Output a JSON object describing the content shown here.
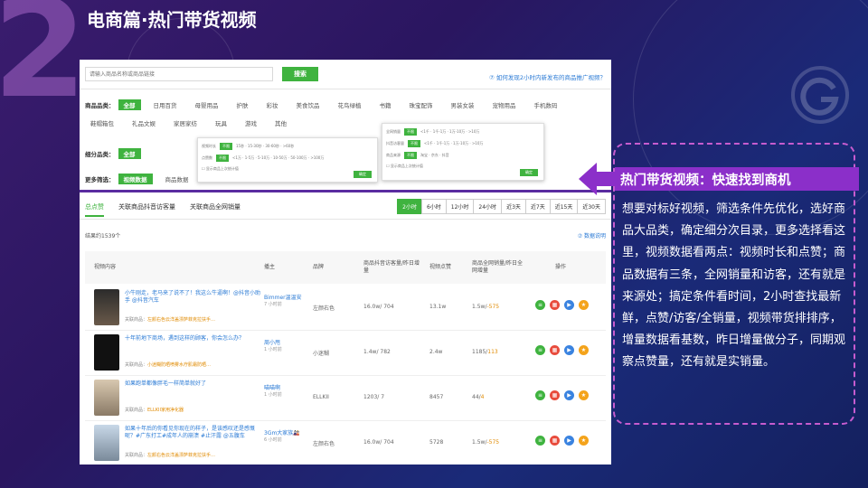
{
  "slide": {
    "number": "2",
    "title": "电商篇·热门带货视频"
  },
  "search": {
    "placeholder": "请输入商品名称或商品链接",
    "button_label": "搜索",
    "help_link": "⑦ 如何发现2小时内新发布的商品推广视频？"
  },
  "filters": {
    "category_label": "商品品类：",
    "categories": [
      "全部",
      "日用百货",
      "母婴用品",
      "护肤",
      "彩妆",
      "美食饮品",
      "花鸟绿植",
      "书籍",
      "珠宝配饰",
      "男装女装",
      "宠物用品",
      "手机数码",
      "鞋帽箱包",
      "礼品文娱",
      "家居家纺",
      "玩具",
      "游戏",
      "其他"
    ],
    "subcategory_label": "细分品类：",
    "subcategory_selected": "全部",
    "more_label": "更多筛选：",
    "more_options": [
      "视频数据",
      "商品数据"
    ]
  },
  "tabs": {
    "items": [
      "总点赞",
      "关联商品抖音访客量",
      "关联商品全网销量"
    ],
    "active_index": 0
  },
  "time_filters": {
    "items": [
      "2小时",
      "6小时",
      "12小时",
      "24小时",
      "近3天",
      "近7天",
      "近15天",
      "近30天"
    ],
    "active_index": 0
  },
  "results": {
    "count_text": "结果约1539个",
    "data_explain": "⑦ 数据说明"
  },
  "table": {
    "headers": [
      "视频内容",
      "播主",
      "品牌",
      "商品抖音访客量/昨日增量",
      "视频点赞",
      "商品全网销量/昨日全网增量",
      "操作"
    ],
    "rows": [
      {
        "title": "小牛刚走，老马来了说不了！我这么牛逼啊！@抖音小助手 @抖音汽车",
        "related_label": "关联商品：",
        "related": "左颜右色云洋盖漂萨菲克拉扶手…",
        "author": "Bimmer温温安",
        "ago": "7 小时前",
        "brand": "左颜右色",
        "visits": "16.0w/ 704",
        "likes": "13.1w",
        "sales": "1.5w/",
        "sales_inc": "-575"
      },
      {
        "title": "十年前地下商场，遇到这样的顾客，你会怎么办？",
        "related_label": "关联商品：",
        "related": "小迷糊防晒喷雾水疗肌霜防晒…",
        "author": "周小甩",
        "ago": "1 小时前",
        "brand": "小迷糊",
        "visits": "1.4w/ 782",
        "likes": "2.4w",
        "sales": "1185/",
        "sales_inc": "113"
      },
      {
        "title": "如果跑单都像胖毛一样简单就好了",
        "related_label": "关联商品：",
        "related": "ELLKII家用净化器",
        "author": "喵喵啊",
        "ago": "1 小时前",
        "brand": "ELLKII",
        "visits": "1203/ 7",
        "likes": "8457",
        "sales": "44/",
        "sales_inc": "4"
      },
      {
        "title": "如果十年后的你看见你现在的样子，是该感叹还是感慨呢？#广东打工#成年人的崩溃 #止汗露 @五腹车",
        "related_label": "关联商品：",
        "related": "左颜右色云洋盖漂萨菲克拉扶手…",
        "author": "3Gm大家族🎎",
        "ago": "6 小时前",
        "brand": "左颜右色",
        "visits": "16.0w/ 704",
        "likes": "5728",
        "sales": "1.5w/",
        "sales_inc": "-575"
      }
    ]
  },
  "callout": {
    "title": "热门带货视频：快速找到商机",
    "text": "想要对标好视频，筛选条件先优化，选好商品大品类，确定细分次目录，更多选择看这里，视频数据看两点：视频时长和点赞；商品数据有三条，全网销量和访客，还有就是来源处；搞定条件看时间，2小时查找最新鲜，点赞/访客/全销量，视频带货排排序，增量数据看基数，昨日增量做分子，同期观察点赞量，还有就是实销量。"
  },
  "colors": {
    "accent_green": "#3fb33f",
    "callout_purple": "#8b2fc9",
    "link_blue": "#2a7ad5",
    "orange": "#e08a00"
  }
}
